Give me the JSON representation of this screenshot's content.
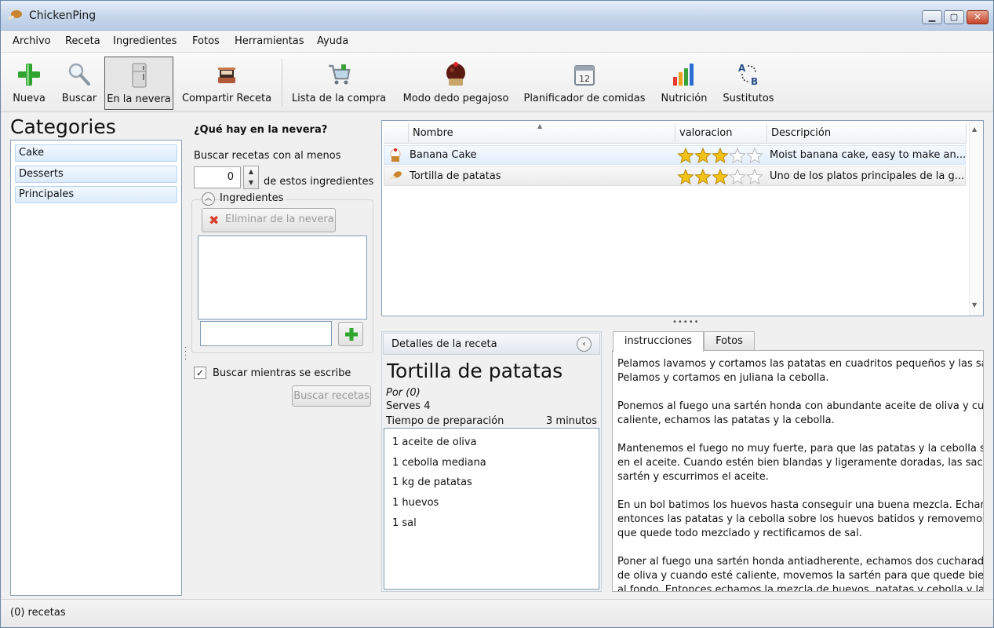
{
  "window": {
    "title": "ChickenPing",
    "minimize": "▁",
    "maximize": "▢",
    "close": "✕"
  },
  "menu": [
    "Archivo",
    "Receta",
    "Ingredientes",
    "Fotos",
    "Herramientas",
    "Ayuda"
  ],
  "toolbar": [
    {
      "label": "Nueva",
      "icon": "plus-icon"
    },
    {
      "label": "Buscar",
      "icon": "magnifier-icon"
    },
    {
      "label": "En la nevera",
      "icon": "fridge-icon",
      "active": true
    },
    {
      "label": "Compartir Receta",
      "icon": "share-icon"
    },
    {
      "label": "Lista de la compra",
      "icon": "cart-icon"
    },
    {
      "label": "Modo dedo pegajoso",
      "icon": "cupcake-icon"
    },
    {
      "label": "Planificador de comidas",
      "icon": "calendar-icon"
    },
    {
      "label": "Nutrición",
      "icon": "bar-chart-icon"
    },
    {
      "label": "Sustitutos",
      "icon": "substitute-icon"
    }
  ],
  "categories": {
    "title": "Categories",
    "items": [
      "Cake",
      "Desserts",
      "Principales"
    ]
  },
  "fridge": {
    "title": "¿Qué hay en la nevera?",
    "search_min_label": "Buscar recetas con al menos",
    "min_count": "0",
    "of_these_label": "de estos ingredientes",
    "ingredients_group": "Ingredientes",
    "remove_button": "Eliminar de la nevera",
    "add_input_value": "",
    "search_while_typing": "Buscar mientras se escribe",
    "search_while_typing_checked": true,
    "search_button": "Buscar recetas"
  },
  "recipes": {
    "columns": [
      "Nombre",
      "valoracion",
      "Descripción"
    ],
    "rows": [
      {
        "icon": "cupcake-icon",
        "name": "Banana Cake",
        "rating": 3,
        "max_rating": 5,
        "description": "Moist banana cake, easy to make an..."
      },
      {
        "icon": "drumstick-icon",
        "name": "Tortilla de patatas",
        "rating": 3,
        "max_rating": 5,
        "description": "Uno de los platos principales de la g..."
      }
    ]
  },
  "details": {
    "header": "Detalles de la receta",
    "title": "Tortilla de patatas",
    "author": "Por (0)",
    "serves": "Serves 4",
    "prep_label": "Tiempo de preparación",
    "prep_value": "3 minutos",
    "ingredients": [
      "1  aceite de oliva",
      "1  cebolla mediana",
      "1 kg de patatas",
      "1  huevos",
      "1  sal"
    ]
  },
  "tabs": [
    "instrucciones",
    "Fotos"
  ],
  "instructions": [
    [
      "Pelamos lavamos y cortamos las patatas en cuadritos pequeños y las sal",
      "Pelamos y cortamos en juliana la cebolla."
    ],
    [
      "Ponemos al fuego una sartén honda con abundante aceite de oliva y cua",
      "caliente, echamos las patatas y la cebolla."
    ],
    [
      "Mantenemos el fuego no muy fuerte, para que las patatas y la cebolla se",
      "en el aceite. Cuando estén bien blandas y ligeramente doradas, las saca",
      "sartén y escurrimos el aceite."
    ],
    [
      "En un bol batimos los huevos hasta conseguir una buena mezcla. Echam",
      "entonces las patatas y la cebolla sobre los huevos batidos y removemos",
      "que quede todo mezclado y rectificamos de sal."
    ],
    [
      "Poner al fuego una sartén honda antiadherente, echamos dos cucharada",
      "de oliva y cuando esté caliente, movemos la sartén para que quede bien",
      "al fondo. Entonces echamos la mezcla de huevos, patatas y cebolla y la"
    ]
  ],
  "status": "(0) recetas",
  "colors": {
    "star": "#f2c21a",
    "selection": "#dcebfc",
    "add_green": "#2fa52f",
    "remove_red": "#d9402b"
  }
}
